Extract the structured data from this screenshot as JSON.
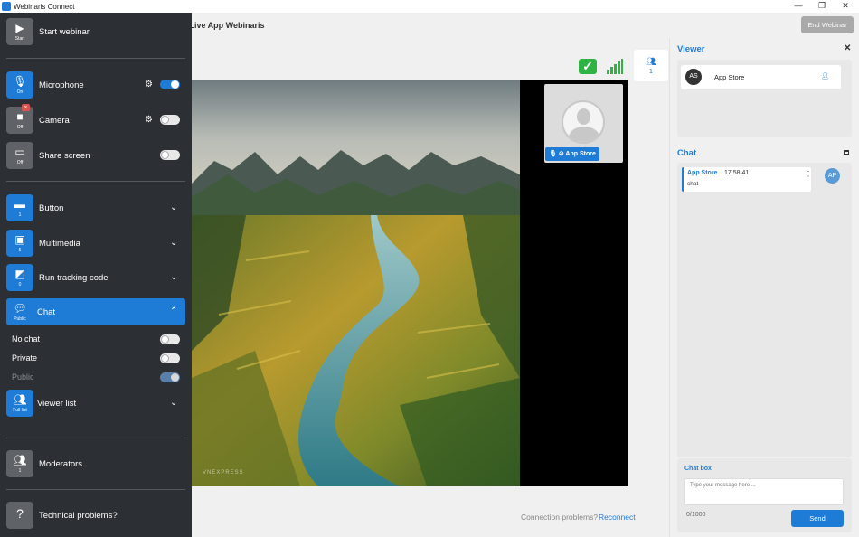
{
  "window": {
    "app_name": "Webinaris Connect",
    "controls": [
      "—",
      "❐",
      "✕"
    ]
  },
  "topbar": {
    "title": "t Live App Webinaris",
    "end_button": "End Webinar",
    "viewer_count": "1"
  },
  "sidebar": {
    "start": {
      "label": "Start webinar",
      "cap": "Start"
    },
    "microphone": {
      "label": "Microphone",
      "cap": "On",
      "on": true
    },
    "camera": {
      "label": "Camera",
      "cap": "Off",
      "on": false
    },
    "share": {
      "label": "Share screen",
      "cap": "Off",
      "on": false
    },
    "button": {
      "label": "Button",
      "cap": "1"
    },
    "multimedia": {
      "label": "Multimedia",
      "cap": "5"
    },
    "tracking": {
      "label": "Run tracking code",
      "cap": "0"
    },
    "chat": {
      "label": "Chat",
      "cap": "Public",
      "options": [
        {
          "label": "No chat",
          "state": "off"
        },
        {
          "label": "Private",
          "state": "off"
        },
        {
          "label": "Public",
          "state": "on"
        }
      ]
    },
    "viewer_list": {
      "label": "Viewer list",
      "cap": "Full list"
    },
    "moderators": {
      "label": "Moderators",
      "cap": "1"
    },
    "tech": {
      "label": "Technical problems?"
    }
  },
  "stage": {
    "camera_name": "App Store",
    "watermark": "VNEXPRESS"
  },
  "connection": {
    "question": "Connection problems?",
    "reconnect": "Reconnect"
  },
  "right_panel": {
    "viewer_title": "Viewer",
    "viewers": [
      {
        "initials": "AS",
        "name": "App Store"
      }
    ],
    "chat_title": "Chat",
    "messages": [
      {
        "author": "App Store",
        "time": "17:58:41",
        "text": "chat",
        "avatar": "AP"
      }
    ],
    "chatbox": {
      "title": "Chat box",
      "placeholder": "Type your message here ...",
      "counter": "0/1000",
      "send": "Send"
    }
  },
  "colors": {
    "accent": "#1e7bd6",
    "sidebar": "#2c2f33",
    "ok": "#2fb344"
  }
}
